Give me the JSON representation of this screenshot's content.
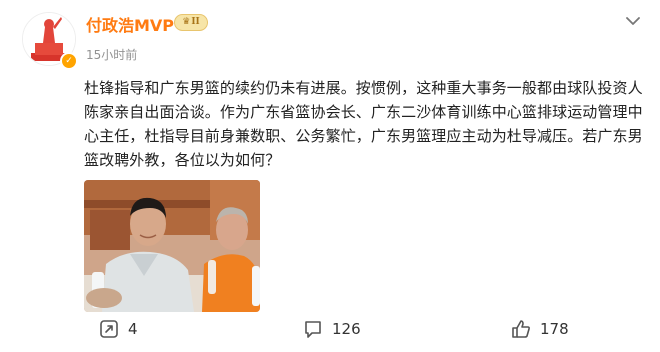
{
  "post": {
    "username": "付政浩MVP",
    "vip_level": "II",
    "timestamp": "15小时前",
    "text": "杜锋指导和广东男篮的续约仍未有进展。按惯例，这种重大事务一般都由球队投资人陈家亲自出面洽谈。作为广东省篮协会长、广东二沙体育训练中心篮排球运动管理中心主任，杜指导目前身兼数职、公务繁忙，广东男篮理应主动为杜导减压。若广东男篮改聘外教，各位以为如何？",
    "icons": {
      "more": "chevron-down-icon",
      "avatar_badge": "verified-badge-icon",
      "vip": "crown-icon"
    }
  },
  "actions": {
    "repost_count": "4",
    "comment_count": "126",
    "like_count": "178"
  },
  "colors": {
    "username": "#ff7b12",
    "timestamp": "#939393",
    "vip_badge": "#f7e5a8",
    "text": "#222222"
  }
}
